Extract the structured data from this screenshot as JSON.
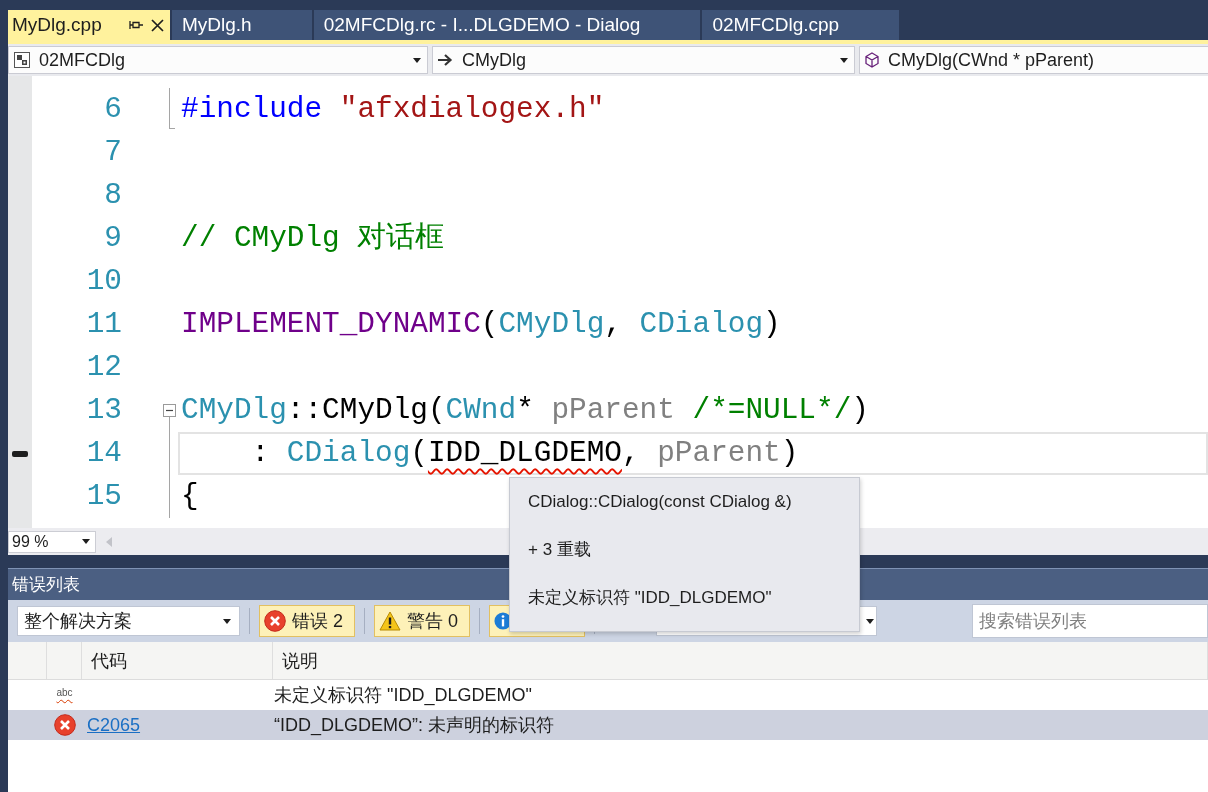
{
  "tabs": [
    {
      "label": "MyDlg.cpp",
      "selected": true
    },
    {
      "label": "MyDlg.h",
      "selected": false
    },
    {
      "label": "02MFCDlg.rc - I...DLGDEMO - Dialog",
      "selected": false
    },
    {
      "label": "02MFCDlg.cpp",
      "selected": false
    }
  ],
  "navigation": [
    {
      "kind": "project",
      "text": "02MFCDlg"
    },
    {
      "kind": "scope",
      "text": "CMyDlg"
    },
    {
      "kind": "member",
      "text": "CMyDlg(CWnd * pParent)"
    }
  ],
  "editor": {
    "lines": [
      {
        "number": "6",
        "current": false,
        "kind": "closing",
        "tokens": [
          {
            "text": "#include ",
            "kind": "directive"
          },
          {
            "text": "\"afxdialogex.h\"",
            "kind": "string"
          }
        ]
      },
      {
        "number": "7",
        "current": false,
        "kind": "plain"
      },
      {
        "number": "8",
        "current": false,
        "kind": "plain"
      },
      {
        "number": "9",
        "current": false,
        "kind": "plain",
        "tokens": [
          {
            "text": "// CMyDlg 对话框",
            "kind": "comment"
          }
        ]
      },
      {
        "number": "10",
        "current": false,
        "kind": "plain"
      },
      {
        "number": "11",
        "current": false,
        "kind": "plain",
        "tokens": [
          {
            "text": "IMPLEMENT_DYNAMIC",
            "kind": "macro"
          },
          {
            "text": "(",
            "kind": "plain"
          },
          {
            "text": "CMyDlg",
            "kind": "type"
          },
          {
            "text": ", ",
            "kind": "plain"
          },
          {
            "text": "CDialog",
            "kind": "type"
          },
          {
            "text": ")",
            "kind": "plain"
          }
        ]
      },
      {
        "number": "12",
        "current": false,
        "kind": "plain"
      },
      {
        "number": "13",
        "current": false,
        "kind": "header",
        "tokens": [
          {
            "text": "CMyDlg",
            "kind": "type"
          },
          {
            "text": "::CMyDlg(",
            "kind": "plain"
          },
          {
            "text": "CWnd",
            "kind": "type"
          },
          {
            "text": "* ",
            "kind": "plain"
          },
          {
            "text": "pParent ",
            "kind": "param"
          },
          {
            "text": "/*=NULL*/",
            "kind": "comment"
          },
          {
            "text": ")",
            "kind": "plain"
          }
        ]
      },
      {
        "number": "14",
        "current": true,
        "kind": "body",
        "tokens": [
          {
            "text": "    : ",
            "kind": "plain"
          },
          {
            "text": "CDialog",
            "kind": "type"
          },
          {
            "text": "(",
            "kind": "plain"
          },
          {
            "text": "IDD_DLGDEMO",
            "kind": "error"
          },
          {
            "text": ", ",
            "kind": "plain"
          },
          {
            "text": "pParent",
            "kind": "param"
          },
          {
            "text": ")",
            "kind": "plain"
          }
        ]
      },
      {
        "number": "15",
        "current": false,
        "kind": "body",
        "tokens": [
          {
            "text": "{",
            "kind": "plain"
          }
        ]
      }
    ],
    "zoom": "99 %"
  },
  "tooltip": {
    "lines": [
      "CDialog::CDialog(const CDialog &)",
      "+ 3 重载",
      "未定义标识符 \"IDD_DLGDEMO\""
    ]
  },
  "error_list": {
    "title": "错误列表",
    "scope": "整个解决方案",
    "filters": [
      {
        "kind": "errors",
        "label": "错误 2",
        "on": true
      },
      {
        "kind": "warnings",
        "label": "警告 0",
        "on": true
      },
      {
        "kind": "messages",
        "on": true
      }
    ],
    "search": {
      "placeholder": "搜索错误列表"
    },
    "columns": [
      "代码",
      "说明"
    ],
    "rows": [
      {
        "kind": "intellisense",
        "icon_label": "abc",
        "description": "未定义标识符 \"IDD_DLGDEMO\"",
        "selected": false
      },
      {
        "kind": "error",
        "code": "C2065",
        "description": "“IDD_DLGDEMO”: 未声明的标识符",
        "selected": true
      }
    ]
  }
}
